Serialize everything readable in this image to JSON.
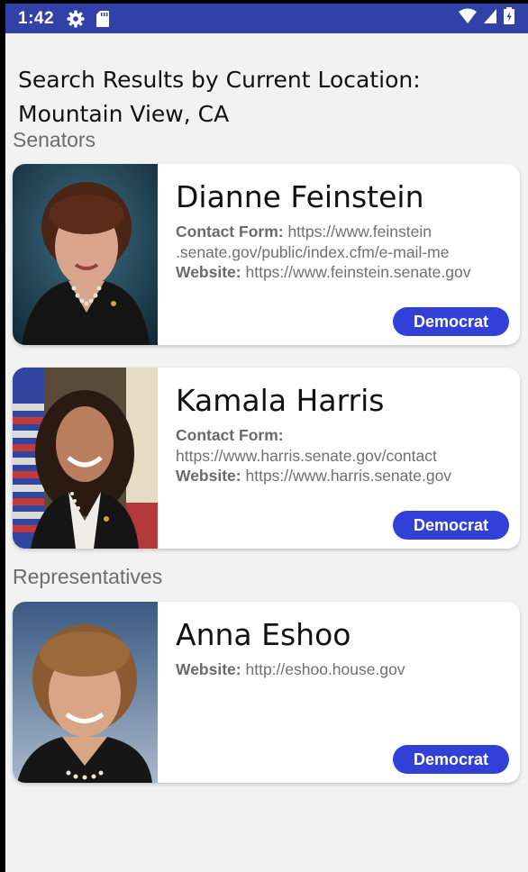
{
  "status_bar": {
    "time": "1:42",
    "icons": [
      "gear-icon",
      "sd-card-icon",
      "wifi-icon",
      "signal-icon",
      "battery-icon"
    ]
  },
  "header": {
    "title_line1": "Search Results by Current Location:",
    "title_line2": "Mountain View, CA"
  },
  "sections": {
    "senators_label": "Senators",
    "representatives_label": "Representatives"
  },
  "cards": [
    {
      "name": "Dianne Feinstein",
      "contact_label": "Contact Form:",
      "contact_value_1": "https://www.feinstein",
      "contact_value_2": ".senate.gov/public/index.cfm/e-mail-me",
      "website_label": "Website:",
      "website_value": "https://www.feinstein.senate.gov",
      "party": "Democrat"
    },
    {
      "name": "Kamala Harris",
      "contact_label": "Contact Form:",
      "contact_value_1": "https://www.harris.senate.gov/contact",
      "website_label": "Website:",
      "website_value": "https://www.harris.senate.gov",
      "party": "Democrat"
    },
    {
      "name": "Anna Eshoo",
      "website_label": "Website:",
      "website_value": "http://eshoo.house.gov",
      "party": "Democrat"
    }
  ],
  "colors": {
    "status_bar": "#3141a8",
    "party_button": "#3141d8",
    "background": "#f2f2f2"
  }
}
